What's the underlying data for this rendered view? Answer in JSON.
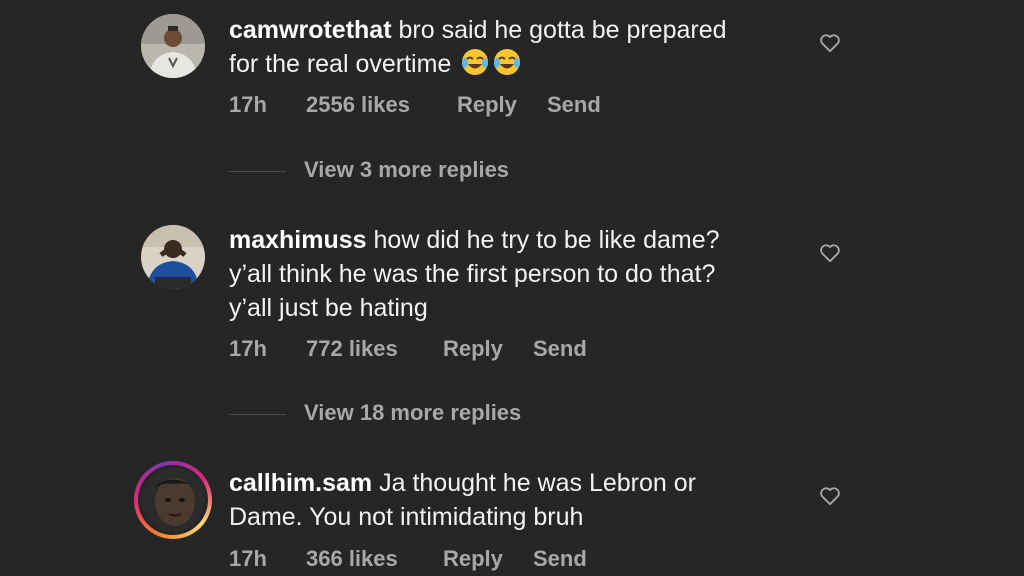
{
  "comments": [
    {
      "username": "camwrotethat",
      "line1": "bro said he gotta be prepared",
      "line2": "for the real overtime",
      "emoji": [
        "face-with-tears-of-joy",
        "face-with-tears-of-joy"
      ],
      "time": "17h",
      "likes": "2556 likes",
      "reply": "Reply",
      "send": "Send",
      "view_more": "View 3 more replies"
    },
    {
      "username": "maxhimuss",
      "line1": "how did he try to be like dame?",
      "line2": "y’all think he was the first person to do that?",
      "line3": "y’all just be hating",
      "time": "17h",
      "likes": "772 likes",
      "reply": "Reply",
      "send": "Send",
      "view_more": "View 18 more replies"
    },
    {
      "username": "callhim.sam",
      "line1": "Ja thought he was Lebron or",
      "line2": "Dame. You not intimidating bruh",
      "time": "17h",
      "likes": "366 likes",
      "reply": "Reply",
      "send": "Send",
      "has_story_ring": true
    }
  ],
  "colors": {
    "background": "#262626",
    "text": "#f2f2f2",
    "secondary_text": "#a8a8a8",
    "story_ring_start": "#f58529",
    "story_ring_end": "#dd2a7b"
  },
  "icons": {
    "like": "heart-outline-icon",
    "emoji": "face-with-tears-of-joy"
  }
}
